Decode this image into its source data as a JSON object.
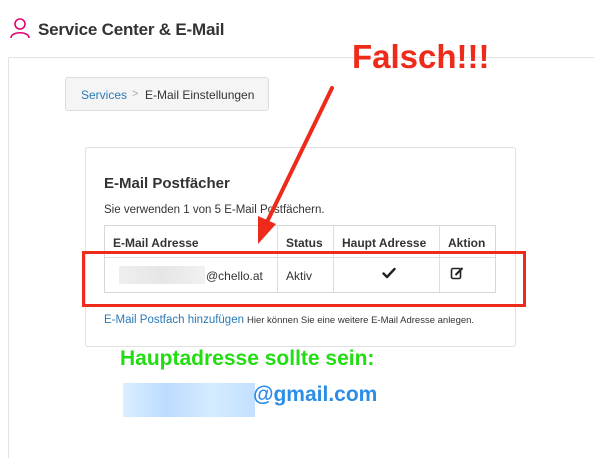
{
  "header": {
    "title": "Service Center & E-Mail",
    "icon": "user-icon"
  },
  "breadcrumb": {
    "link": "Services",
    "separator": ">",
    "current": "E-Mail Einstellungen"
  },
  "card": {
    "title": "E-Mail Postfächer",
    "subtitle": "Sie verwenden 1 von 5 E-Mail Postfächern.",
    "table": {
      "headers": [
        "E-Mail Adresse",
        "Status",
        "Haupt Adresse",
        "Aktion"
      ],
      "rows": [
        {
          "email": "@chello.at",
          "status": "Aktiv",
          "main": "✔",
          "action_icon": "edit-icon"
        }
      ]
    },
    "add_link": "E-Mail Postfach hinzufügen",
    "add_hint": "Hier können Sie eine weitere E-Mail Adresse anlegen."
  },
  "annotations": {
    "falsch": "Falsch!!!",
    "hint": "Hauptadresse sollte sein:",
    "email": "@gmail.com",
    "color_red": "#ee2b1a",
    "color_green": "#22dd11",
    "color_blue": "#2b8de6"
  }
}
